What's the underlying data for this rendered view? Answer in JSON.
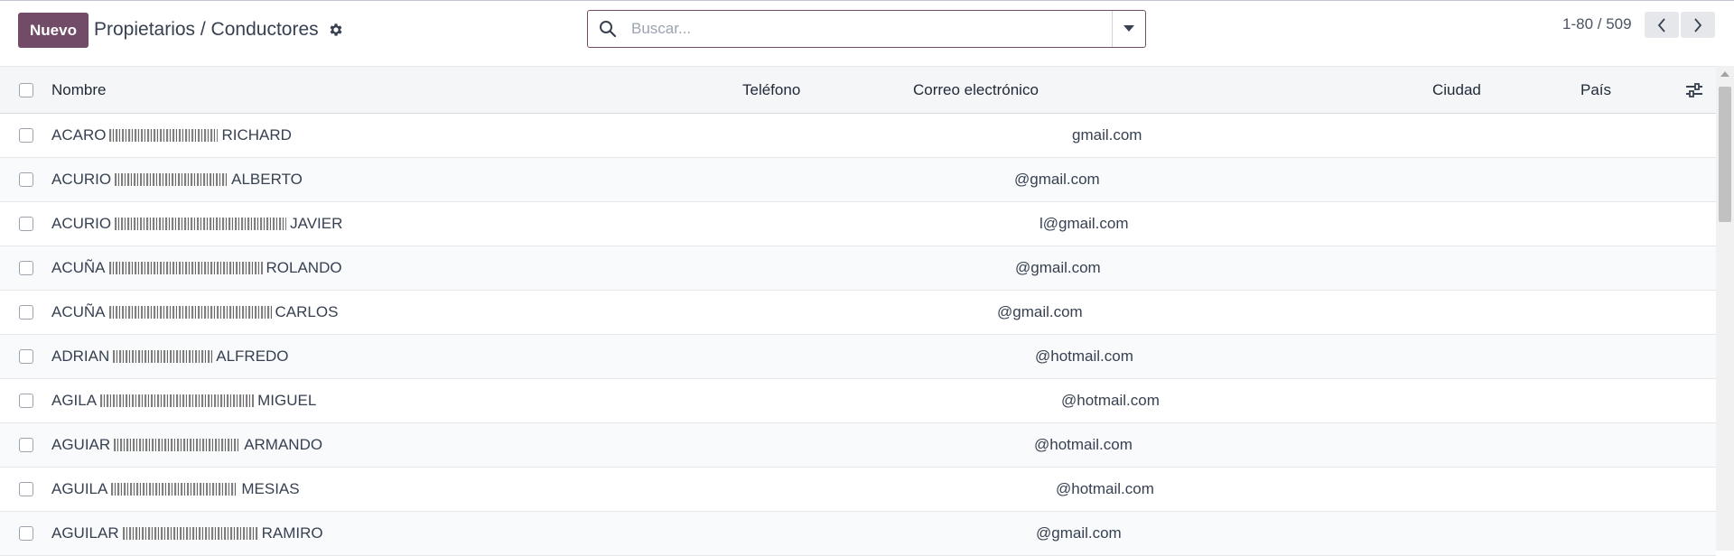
{
  "toolbar": {
    "new_label": "Nuevo",
    "breadcrumb": "Propietarios / Conductores",
    "settings_icon": "gear-icon"
  },
  "search": {
    "placeholder": "Buscar...",
    "value": "",
    "icon": "search-icon",
    "dropdown_icon": "caret-down-icon"
  },
  "pager": {
    "text": "1-80 / 509",
    "prev_icon": "chevron-left-icon",
    "next_icon": "chevron-right-icon"
  },
  "table": {
    "columns": {
      "name": "Nombre",
      "phone": "Teléfono",
      "email": "Correo electrónico",
      "city": "Ciudad",
      "country": "País",
      "options_icon": "sliders-icon"
    },
    "rows": [
      {
        "first": "ACARO",
        "last": "RICHARD",
        "email": "gmail.com"
      },
      {
        "first": "ACURIO",
        "last": "ALBERTO",
        "email": "@gmail.com"
      },
      {
        "first": "ACURIO",
        "last": "JAVIER",
        "email": "l@gmail.com"
      },
      {
        "first": "ACUÑA",
        "last": "ROLANDO",
        "email": "@gmail.com"
      },
      {
        "first": "ACUÑA",
        "last": "CARLOS",
        "email": "@gmail.com"
      },
      {
        "first": "ADRIAN",
        "last": "ALFREDO",
        "email": "@hotmail.com"
      },
      {
        "first": "AGILA",
        "last": "MIGUEL",
        "email": "@hotmail.com"
      },
      {
        "first": "AGUIAR",
        "last": "ARMANDO",
        "email": "@hotmail.com"
      },
      {
        "first": "AGUILA",
        "last": "MESIAS",
        "email": "@hotmail.com"
      },
      {
        "first": "AGUILAR",
        "last": "RAMIRO",
        "email": "@gmail.com"
      }
    ]
  },
  "colors": {
    "accent": "#714b67",
    "header_bg": "#f5f6f7",
    "text": "#374151"
  }
}
